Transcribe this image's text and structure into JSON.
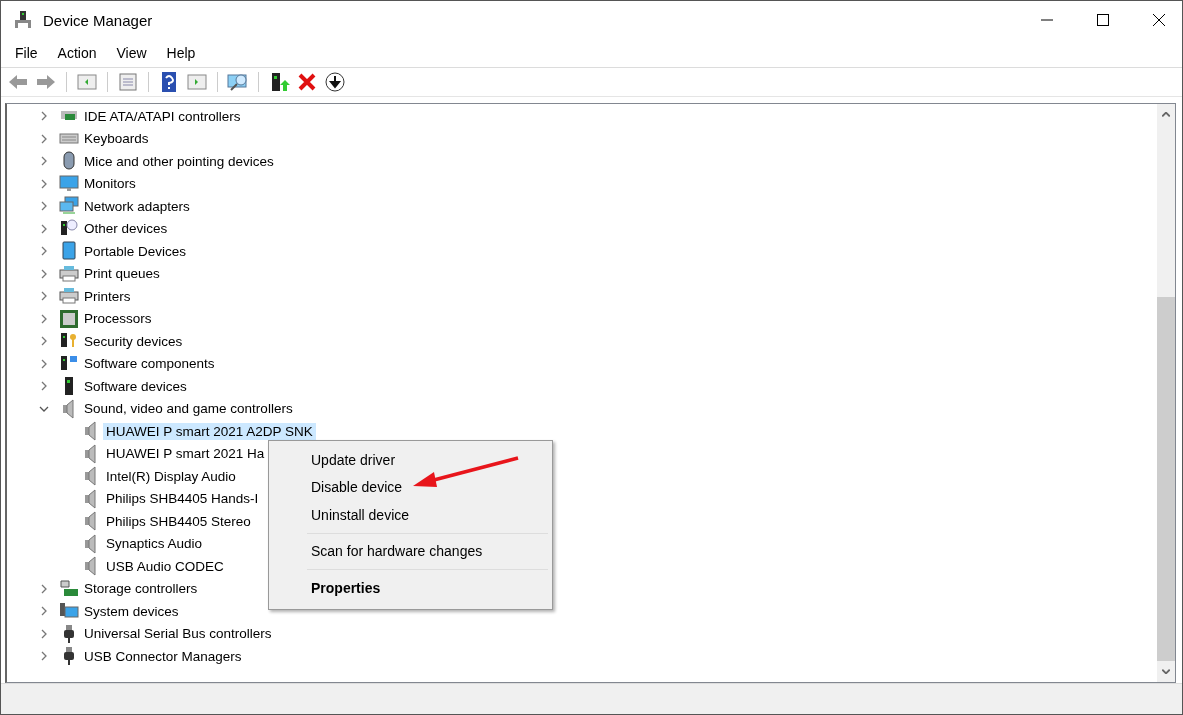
{
  "window": {
    "title": "Device Manager"
  },
  "menu_bar": [
    "File",
    "Action",
    "View",
    "Help"
  ],
  "tree": [
    {
      "label": "IDE ATA/ATAPI controllers",
      "expanded": false
    },
    {
      "label": "Keyboards",
      "expanded": false
    },
    {
      "label": "Mice and other pointing devices",
      "expanded": false
    },
    {
      "label": "Monitors",
      "expanded": false
    },
    {
      "label": "Network adapters",
      "expanded": false
    },
    {
      "label": "Other devices",
      "expanded": false
    },
    {
      "label": "Portable Devices",
      "expanded": false
    },
    {
      "label": "Print queues",
      "expanded": false
    },
    {
      "label": "Printers",
      "expanded": false
    },
    {
      "label": "Processors",
      "expanded": false
    },
    {
      "label": "Security devices",
      "expanded": false
    },
    {
      "label": "Software components",
      "expanded": false
    },
    {
      "label": "Software devices",
      "expanded": false
    },
    {
      "label": "Sound, video and game controllers",
      "expanded": true,
      "children": [
        {
          "label": "HUAWEI P smart 2021 A2DP SNK",
          "selected": true
        },
        {
          "label": "HUAWEI P smart 2021 Ha",
          "selected": false
        },
        {
          "label": "Intel(R) Display Audio",
          "selected": false
        },
        {
          "label": "Philips SHB4405 Hands-I",
          "selected": false
        },
        {
          "label": "Philips SHB4405 Stereo",
          "selected": false
        },
        {
          "label": "Synaptics Audio",
          "selected": false
        },
        {
          "label": "USB Audio CODEC",
          "selected": false
        }
      ]
    },
    {
      "label": "Storage controllers",
      "expanded": false
    },
    {
      "label": "System devices",
      "expanded": false
    },
    {
      "label": "Universal Serial Bus controllers",
      "expanded": false
    },
    {
      "label": "USB Connector Managers",
      "expanded": false
    }
  ],
  "context_menu": [
    {
      "kind": "item",
      "label": "Update driver"
    },
    {
      "kind": "item",
      "label": "Disable device"
    },
    {
      "kind": "item",
      "label": "Uninstall device"
    },
    {
      "kind": "separator"
    },
    {
      "kind": "item",
      "label": "Scan for hardware changes"
    },
    {
      "kind": "separator"
    },
    {
      "kind": "default",
      "label": "Properties"
    }
  ]
}
